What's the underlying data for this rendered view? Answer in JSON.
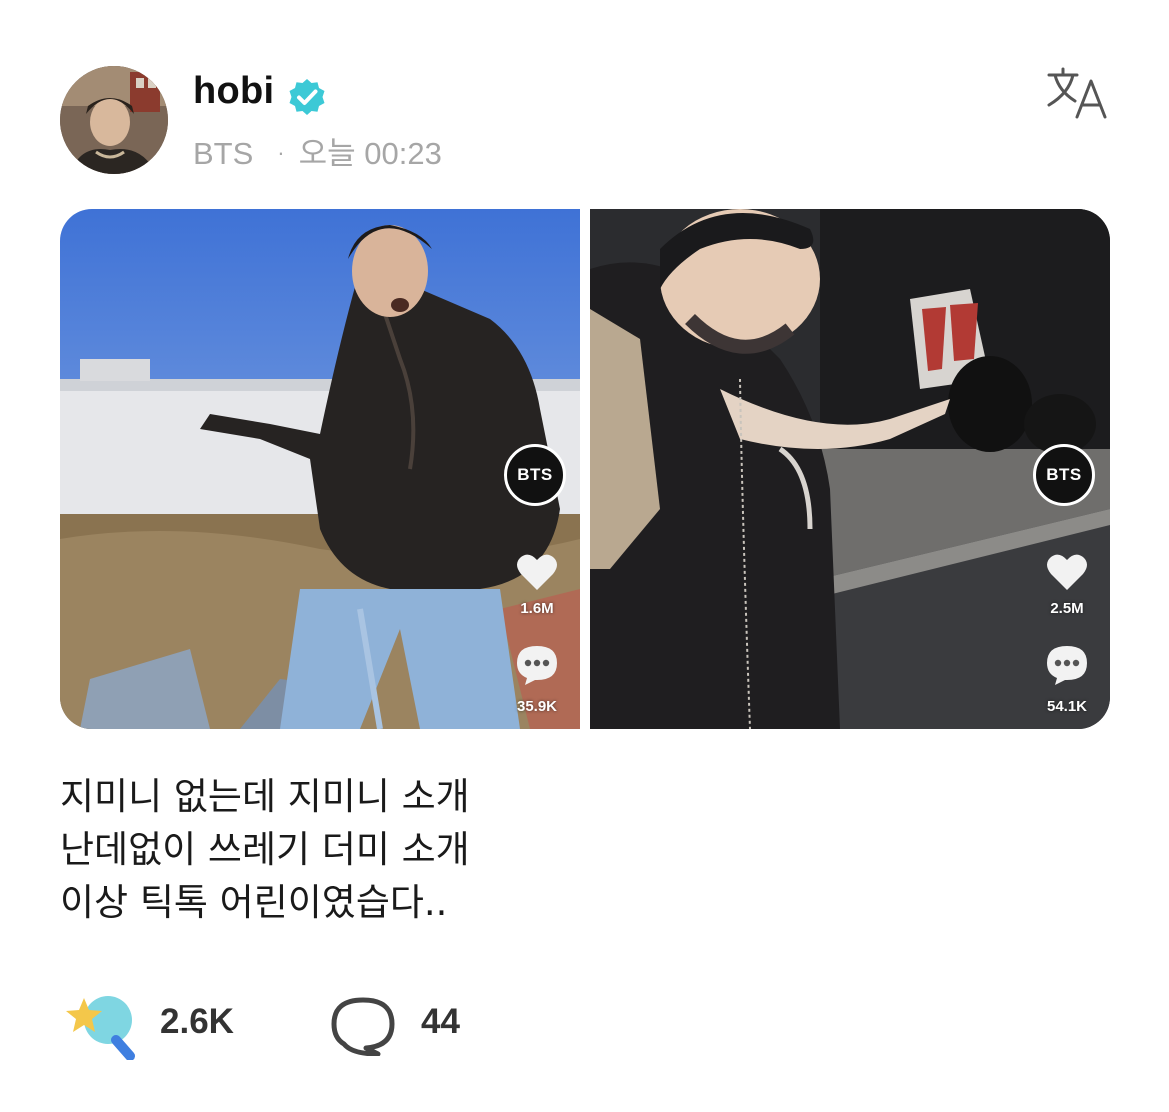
{
  "author": {
    "name": "hobi",
    "group": "BTS",
    "separator": "·",
    "timestamp": "오늘 00:23",
    "verified": true,
    "verified_color": "#3cc9d6"
  },
  "translate": {
    "icon": "translate-icon"
  },
  "media": [
    {
      "badge": "BTS",
      "likes": "1.6M",
      "comments": "35.9K"
    },
    {
      "badge": "BTS",
      "likes": "2.5M",
      "comments": "54.1K"
    }
  ],
  "post": {
    "lines": [
      "지미니 없는데 지미니 소개",
      "난데없이 쓰레기 더미 소개",
      "이상 틱톡 어린이였습다.."
    ]
  },
  "actions": {
    "like_count": "2.6K",
    "comment_count": "44",
    "like_icon": "star-magnifier-icon",
    "comment_icon": "speech-bubble-icon"
  }
}
